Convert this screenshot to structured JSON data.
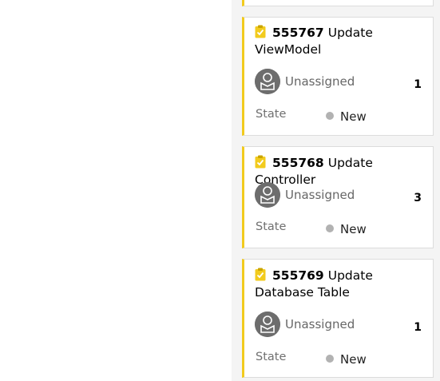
{
  "colors": {
    "card_accent": "#f2cb1d",
    "avatar": "#6d6d6d",
    "state_new": "#b2b2b2",
    "column_bg": "#f4f4f4"
  },
  "cards": [
    {
      "icon": "task-clipboard-icon",
      "id": "555767",
      "title": "Update ViewModel",
      "assignee": "Unassigned",
      "points": "1",
      "state_label": "State",
      "state": "New"
    },
    {
      "icon": "task-clipboard-icon",
      "id": "555768",
      "title": "Update Controller",
      "assignee": "Unassigned",
      "points": "3",
      "state_label": "State",
      "state": "New"
    },
    {
      "icon": "task-clipboard-icon",
      "id": "555769",
      "title": "Update Database Table",
      "assignee": "Unassigned",
      "points": "1",
      "state_label": "State",
      "state": "New"
    }
  ]
}
